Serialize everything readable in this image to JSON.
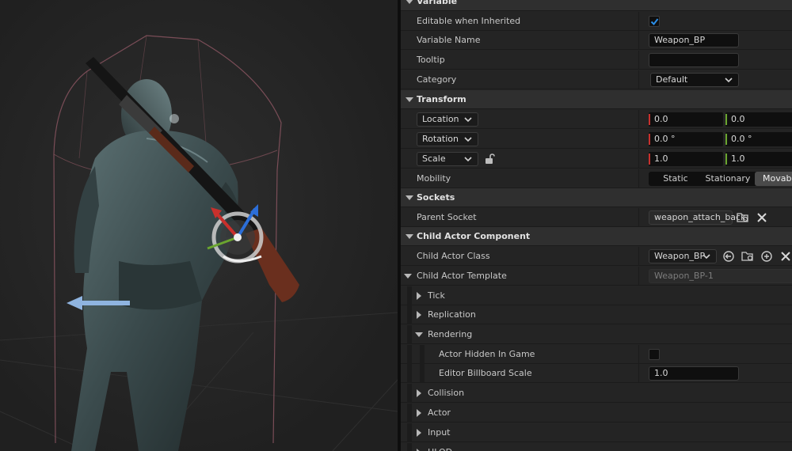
{
  "details": {
    "variable": {
      "title": "Variable",
      "editable_label": "Editable when Inherited",
      "editable_checked": true,
      "name_label": "Variable Name",
      "name_value": "Weapon_BP",
      "tooltip_label": "Tooltip",
      "tooltip_value": "",
      "category_label": "Category",
      "category_value": "Default"
    },
    "transform": {
      "title": "Transform",
      "location": {
        "label": "Location",
        "x": "0.0",
        "y": "0.0"
      },
      "rotation": {
        "label": "Rotation",
        "x": "0.0 °",
        "y": "0.0 °"
      },
      "scale": {
        "label": "Scale",
        "x": "1.0",
        "y": "1.0"
      },
      "mobility_label": "Mobility",
      "mobility_options": [
        "Static",
        "Stationary",
        "Movable"
      ],
      "mobility_selected": "Movable"
    },
    "sockets": {
      "title": "Sockets",
      "parent_socket_label": "Parent Socket",
      "parent_socket_value": "weapon_attach_back"
    },
    "child_actor": {
      "title": "Child Actor Component",
      "class_label": "Child Actor Class",
      "class_value": "Weapon_BP",
      "template_label": "Child Actor Template",
      "template_value": "Weapon_BP-1",
      "groups": {
        "tick": "Tick",
        "replication": "Replication",
        "rendering": "Rendering",
        "collision": "Collision",
        "actor": "Actor",
        "input": "Input",
        "hlod": "HLOD"
      },
      "hidden_label": "Actor Hidden In Game",
      "hidden_checked": false,
      "billboard_label": "Editor Billboard Scale",
      "billboard_value": "1.0"
    }
  },
  "colors": {
    "axis_x": "#c8302c",
    "axis_y": "#6aa52f",
    "check": "#2b8ee8",
    "selected_segment": "#4a4a4a"
  }
}
